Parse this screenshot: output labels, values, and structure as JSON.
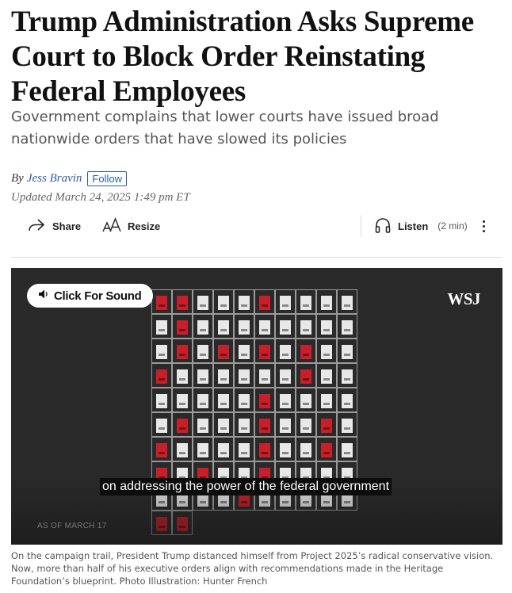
{
  "article": {
    "headline": "Trump Administration Asks Supreme Court to Block Order Reinstating Federal Employees",
    "dek": "Government complains that lower courts have issued broad nationwide orders that have slowed its policies",
    "byline_prefix": "By",
    "author": "Jess Bravin",
    "follow_label": "Follow",
    "updated": "Updated March 24, 2025 1:49 pm ET"
  },
  "toolbar": {
    "share_label": "Share",
    "share_icon": "share-arrow-icon",
    "resize_label": "Resize",
    "resize_icon": "text-size-icon",
    "listen_label": "Listen",
    "listen_duration": "(2 min)",
    "listen_icon": "headphones-icon",
    "more_icon": "vertical-ellipsis-icon"
  },
  "video": {
    "sound_button_label": "Click For Sound",
    "sound_icon": "speaker-icon",
    "brand": "WSJ",
    "subtitle": "on addressing the power of the federal government",
    "as_of": "AS OF MARCH 17",
    "grid_pattern": [
      [
        1,
        1,
        0,
        0,
        0,
        1,
        0,
        0,
        0,
        0
      ],
      [
        0,
        1,
        0,
        0,
        0,
        0,
        0,
        0,
        0,
        0
      ],
      [
        0,
        1,
        0,
        1,
        0,
        1,
        0,
        1,
        0,
        0
      ],
      [
        1,
        0,
        0,
        0,
        0,
        0,
        0,
        1,
        0,
        0
      ],
      [
        0,
        0,
        0,
        0,
        0,
        1,
        0,
        0,
        0,
        0
      ],
      [
        0,
        1,
        0,
        0,
        0,
        1,
        0,
        0,
        1,
        0
      ],
      [
        1,
        0,
        0,
        0,
        0,
        1,
        0,
        0,
        1,
        0
      ],
      [
        1,
        0,
        1,
        0,
        0,
        1,
        0,
        0,
        0,
        0
      ],
      [
        0,
        0,
        0,
        0,
        1,
        0,
        0,
        0,
        0,
        0
      ],
      [
        1,
        1
      ]
    ],
    "colors": {
      "red": "#c8202b",
      "background": "#2a2a2b"
    }
  },
  "photo_caption": "On the campaign trail, President Trump distanced himself from Project 2025’s radical conservative vision. Now, more than half of his executive orders align with recommendations made in the Heritage Foundation’s blueprint. Photo Illustration: Hunter French"
}
